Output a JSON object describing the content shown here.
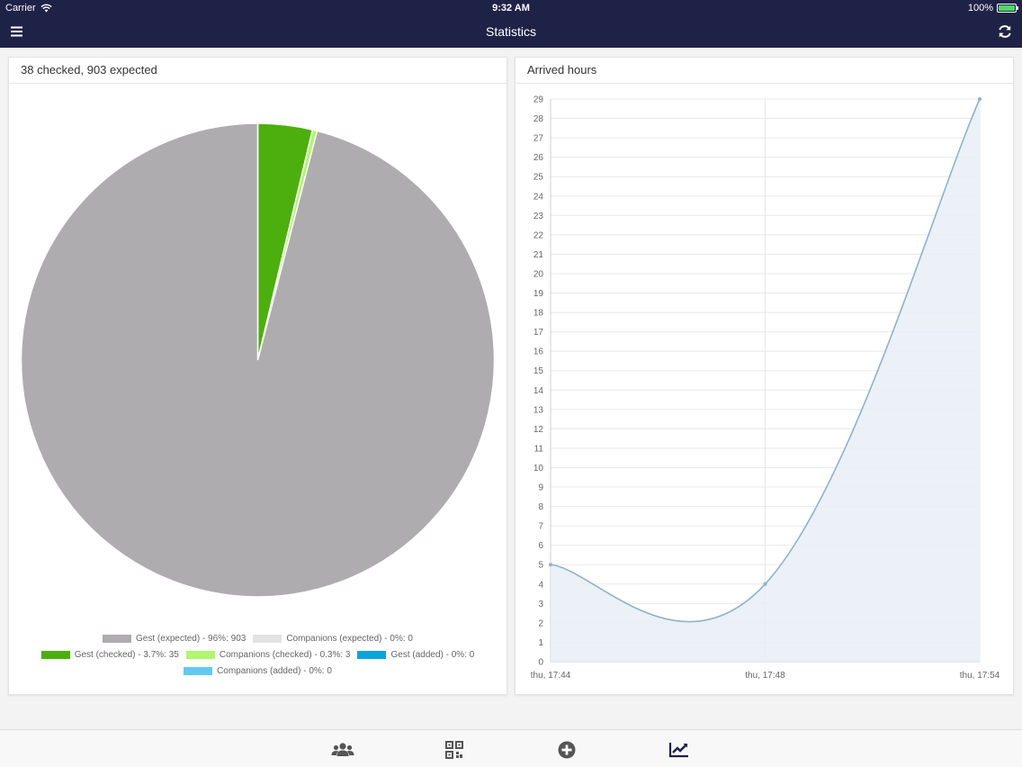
{
  "status_bar": {
    "carrier": "Carrier",
    "time": "9:32 AM",
    "battery": "100%"
  },
  "nav": {
    "title": "Statistics",
    "menu_icon": "hamburger-menu-icon",
    "refresh_icon": "refresh-icon"
  },
  "pie_panel": {
    "title": "38 checked, 903 expected"
  },
  "line_panel": {
    "title": "Arrived hours"
  },
  "chart_data": [
    {
      "type": "pie",
      "slices": [
        {
          "label": "Gest (expected) - 96%: 903",
          "value": 903,
          "color": "#aeacaf"
        },
        {
          "label": "Companions (expected) - 0%: 0",
          "value": 0,
          "color": "#e3e3e3"
        },
        {
          "label": "Gest (checked) - 3.7%: 35",
          "value": 35,
          "color": "#4caf0e"
        },
        {
          "label": "Companions (checked) - 0.3%: 3",
          "value": 3,
          "color": "#b2f56e"
        },
        {
          "label": "Gest (added) - 0%: 0",
          "value": 0,
          "color": "#0aa4dd"
        },
        {
          "label": "Companions (added) - 0%: 0",
          "value": 0,
          "color": "#64c8f5"
        }
      ],
      "legend": "bottom"
    },
    {
      "type": "line",
      "title": "",
      "x": [
        "thu, 17:44",
        "thu, 17:48",
        "thu, 17:54"
      ],
      "series": [
        {
          "values": [
            5,
            4,
            29
          ]
        }
      ],
      "ylim": [
        0,
        29
      ],
      "yticks": [
        "0",
        "1",
        "2",
        "3",
        "4",
        "5",
        "6",
        "7",
        "8",
        "9",
        "10",
        "11",
        "12",
        "13",
        "14",
        "15",
        "16",
        "17",
        "18",
        "19",
        "20",
        "21",
        "22",
        "23",
        "24",
        "25",
        "26",
        "27",
        "28",
        "29"
      ],
      "grid": true,
      "line_color": "#8fb3c8",
      "fill_color": "#e8eef5"
    }
  ],
  "tabs": [
    {
      "icon": "users-icon"
    },
    {
      "icon": "qr-code-icon"
    },
    {
      "icon": "add-circle-icon"
    },
    {
      "icon": "line-chart-icon"
    }
  ]
}
